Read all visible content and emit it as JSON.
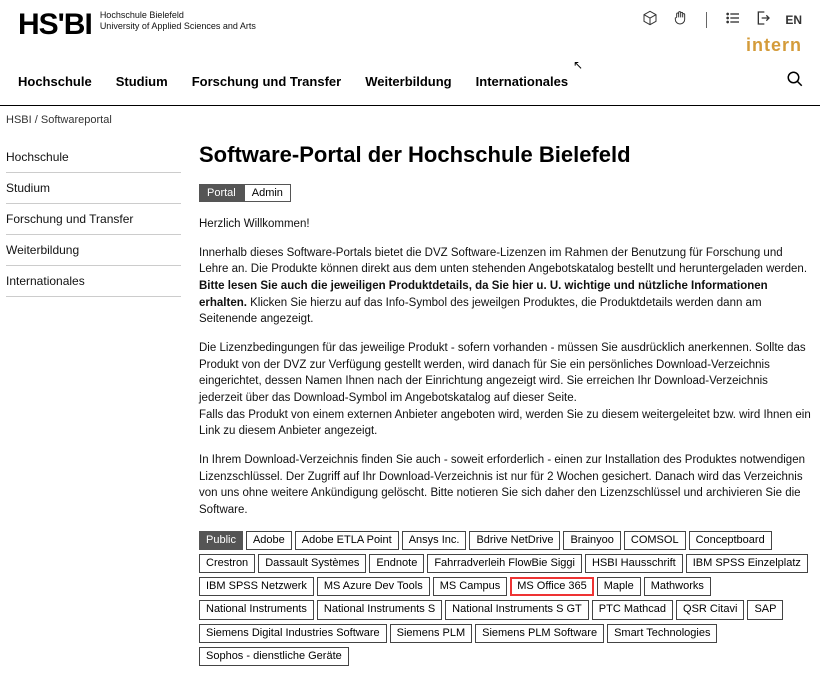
{
  "logo": {
    "text": "HS'BI",
    "sub1": "Hochschule Bielefeld",
    "sub2": "University of Applied Sciences and Arts"
  },
  "top_icons": {
    "lang": "EN",
    "intern": "intern"
  },
  "main_nav": [
    "Hochschule",
    "Studium",
    "Forschung und Transfer",
    "Weiterbildung",
    "Internationales"
  ],
  "breadcrumb": {
    "home": "HSBI",
    "sep": " / ",
    "cur": "Softwareportal"
  },
  "sidebar": [
    "Hochschule",
    "Studium",
    "Forschung und Transfer",
    "Weiterbildung",
    "Internationales"
  ],
  "page": {
    "title": "Software-Portal der Hochschule Bielefeld",
    "tabs": [
      {
        "label": "Portal",
        "active": true
      },
      {
        "label": "Admin",
        "active": false
      }
    ],
    "welcome": "Herzlich Willkommen!",
    "p1_a": "Innerhalb dieses Software-Portals bietet die DVZ Software-Lizenzen im Rahmen der Benutzung für Forschung und Lehre an. Die Produkte können direkt aus dem unten stehenden Angebotskatalog bestellt und heruntergeladen werden. ",
    "p1_b": "Bitte lesen Sie auch die jeweiligen Produktdetails, da Sie hier u. U. wichtige und nützliche Informationen erhalten.",
    "p1_c": " Klicken Sie hierzu auf das Info-Symbol des jeweilgen Produktes, die Produktdetails werden dann am Seitenende angezeigt.",
    "p2": "Die Lizenzbedingungen für das jeweilige Produkt - sofern vorhanden - müssen Sie ausdrücklich anerkennen. Sollte das Produkt von der DVZ zur Verfügung gestellt werden, wird danach für Sie ein persönliches Download-Verzeichnis eingerichtet, dessen Namen Ihnen nach der Einrichtung angezeigt wird. Sie erreichen Ihr Download-Verzeichnis jederzeit über das Download-Symbol im Angebotskatalog auf dieser Seite.",
    "p3": "Falls das Produkt von einem externen Anbieter angeboten wird, werden Sie zu diesem weitergeleitet bzw. wird Ihnen ein Link zu diesem Anbieter angezeigt.",
    "p4": "In Ihrem Download-Verzeichnis finden Sie auch - soweit erforderlich - einen zur Installation des Produktes notwendigen Lizenzschlüssel. Der Zugriff auf Ihr Download-Verzeichnis ist nur für 2 Wochen gesichert. Danach wird das Verzeichnis von uns ohne weitere Ankündigung gelöscht. Bitte notieren Sie sich daher den Lizenzschlüssel und archivieren Sie die Software.",
    "categories": [
      {
        "label": "Public",
        "active": true
      },
      {
        "label": "Adobe"
      },
      {
        "label": "Adobe ETLA Point"
      },
      {
        "label": "Ansys Inc."
      },
      {
        "label": "Bdrive NetDrive"
      },
      {
        "label": "Brainyoo"
      },
      {
        "label": "COMSOL"
      },
      {
        "label": "Conceptboard"
      },
      {
        "label": "Crestron"
      },
      {
        "label": "Dassault Systèmes"
      },
      {
        "label": "Endnote"
      },
      {
        "label": "Fahrradverleih FlowBie Siggi"
      },
      {
        "label": "HSBI Hausschrift"
      },
      {
        "label": "IBM SPSS Einzelplatz"
      },
      {
        "label": "IBM SPSS Netzwerk"
      },
      {
        "label": "MS Azure Dev Tools"
      },
      {
        "label": "MS Campus"
      },
      {
        "label": "MS Office 365",
        "highlight": true
      },
      {
        "label": "Maple"
      },
      {
        "label": "Mathworks"
      },
      {
        "label": "National Instruments"
      },
      {
        "label": "National Instruments S"
      },
      {
        "label": "National Instruments S GT"
      },
      {
        "label": "PTC Mathcad"
      },
      {
        "label": "QSR Citavi"
      },
      {
        "label": "SAP"
      },
      {
        "label": "Siemens Digital Industries Software"
      },
      {
        "label": "Siemens PLM"
      },
      {
        "label": "Siemens PLM Software"
      },
      {
        "label": "Smart Technologies"
      },
      {
        "label": "Sophos - dienstliche Geräte"
      }
    ]
  }
}
